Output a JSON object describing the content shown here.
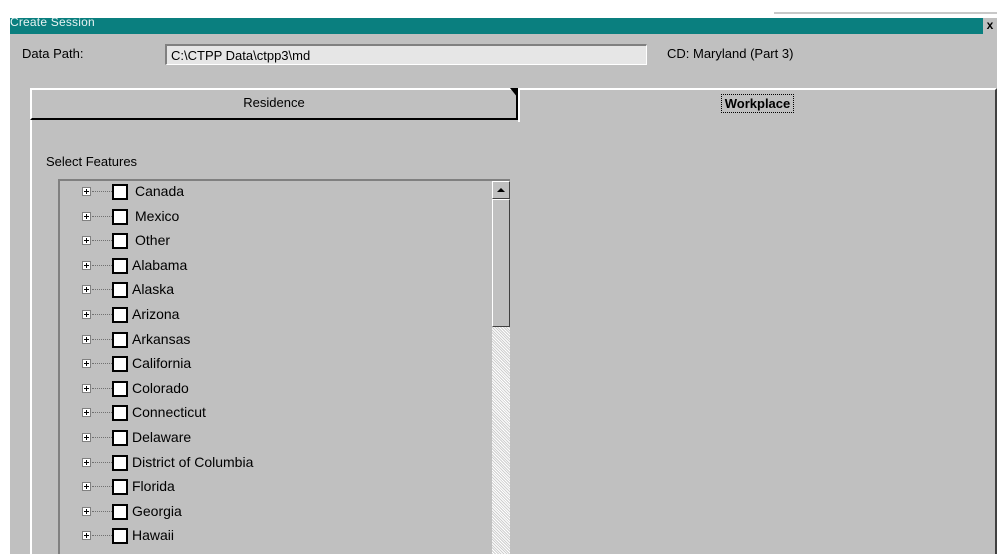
{
  "window": {
    "title": "Create Session",
    "close_label": "x"
  },
  "data_path": {
    "label": "Data Path:",
    "value": "C:\\CTPP Data\\ctpp3\\md"
  },
  "cd_label": "CD: Maryland (Part 3)",
  "tabs": [
    {
      "label": "Residence",
      "active": false
    },
    {
      "label": "Workplace",
      "active": true
    }
  ],
  "features": {
    "label": "Select Features",
    "items": [
      {
        "label": "Canada",
        "checked": false
      },
      {
        "label": "Mexico",
        "checked": false
      },
      {
        "label": "Other",
        "checked": false
      },
      {
        "label": "Alabama",
        "checked": false
      },
      {
        "label": "Alaska",
        "checked": false
      },
      {
        "label": "Arizona",
        "checked": false
      },
      {
        "label": "Arkansas",
        "checked": false
      },
      {
        "label": "California",
        "checked": false
      },
      {
        "label": "Colorado",
        "checked": false
      },
      {
        "label": "Connecticut",
        "checked": false
      },
      {
        "label": "Delaware",
        "checked": false
      },
      {
        "label": "District of Columbia",
        "checked": false
      },
      {
        "label": "Florida",
        "checked": false
      },
      {
        "label": "Georgia",
        "checked": false
      },
      {
        "label": "Hawaii",
        "checked": false
      }
    ]
  },
  "colors": {
    "titlebar": "#0a7f7f",
    "dialog": "#c0c0c0"
  }
}
